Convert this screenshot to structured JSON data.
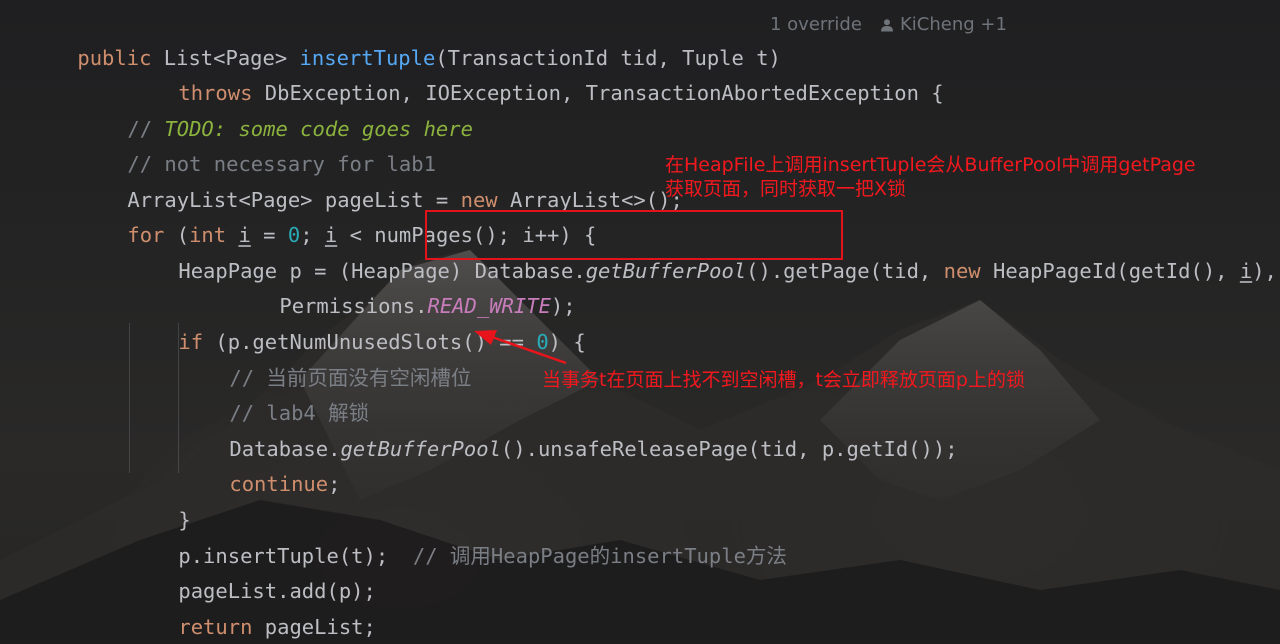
{
  "hints": {
    "overrides": "1 override",
    "authors": "KiCheng +1"
  },
  "code": {
    "l1": {
      "kw": "public",
      "type": "List<Page>",
      "fn": "insertTuple",
      "params": "(TransactionId tid, Tuple t)"
    },
    "l2": {
      "kw": "throws",
      "rest": "DbException, IOException, TransactionAbortedException {"
    },
    "l3": {
      "prefix": "//",
      "todo": "TODO: some code goes here"
    },
    "l4": {
      "comment": "// not necessary for lab1"
    },
    "l5": {
      "decl": "ArrayList<Page> pageList = ",
      "kw": "new",
      "rest": "ArrayList<>();"
    },
    "l6": {
      "kw_for": "for",
      "open": "(",
      "kw_int": "int",
      "var_i": "i",
      "eq": "=",
      "zero": "0",
      "semi": ";",
      "var_i2": "i",
      "cond": "< numPages(); i++) {"
    },
    "l7": {
      "decl": "HeapPage p = (HeapPage) ",
      "db": "Database.",
      "gbp": "getBufferPool",
      "getpage": "().getPage",
      "args1": "(tid, ",
      "kw": "new",
      "args2": "HeapPageId(getId(), ",
      "var_i": "i",
      "end": "),"
    },
    "l8": {
      "perm": "Permissions.",
      "const": "READ_WRITE",
      "end": ");"
    },
    "l9": {
      "kw": "if",
      "mid": "(p.getNumUnusedSlots() == ",
      "zero": "0",
      "end": ") {"
    },
    "l10": {
      "comment": "// 当前页面没有空闲槽位"
    },
    "l11": {
      "comment": "// lab4 解锁"
    },
    "l12": {
      "db": "Database.",
      "gbp": "getBufferPool",
      "rest": "().unsafeReleasePage(tid, p.getId());"
    },
    "l13": {
      "kw": "continue",
      "end": ";"
    },
    "l14": {
      "text": "}"
    },
    "l15": {
      "text": "p.insertTuple(t);",
      "comment": "// 调用HeapPage的insertTuple方法"
    },
    "l16": {
      "text": "pageList.add(p);"
    },
    "l17": {
      "kw": "return",
      "rest": "pageList;"
    },
    "l18": {
      "text": "}"
    }
  },
  "annotations": {
    "top_line1": "在HeapFile上调用insertTuple会从BufferPool中调用getPage",
    "top_line2": "获取页面，同时获取一把X锁",
    "bottom": "当事务t在页面上找不到空闲槽，t会立即释放页面p上的锁"
  },
  "colors": {
    "keyword": "#cf8e6d",
    "function": "#56a8f5",
    "comment": "#7a7e85",
    "todo": "#8bb33d",
    "number": "#2aacb8",
    "constant": "#c77dbb",
    "text": "#bcbec4",
    "annotation_red": "#f2181e"
  },
  "icons": {
    "author": "person-icon"
  }
}
